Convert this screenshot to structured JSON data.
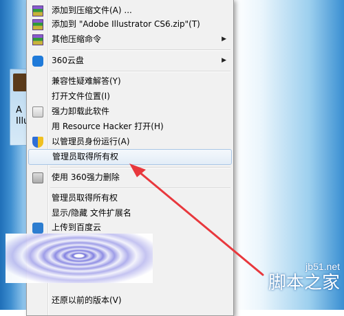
{
  "desktop": {
    "icon_label": "A\nIllu"
  },
  "menu": {
    "items": [
      {
        "label": "添加到压缩文件(A) ...",
        "icon": "winrar-icon"
      },
      {
        "label": "添加到 \"Adobe Illustrator CS6.zip\"(T)",
        "icon": "winrar-icon"
      },
      {
        "label": "其他压缩命令",
        "icon": "winrar-icon",
        "submenu": true
      },
      {
        "label": "360云盘",
        "icon": "cloud-disk-icon",
        "submenu": true
      },
      {
        "label": "兼容性疑难解答(Y)",
        "icon": ""
      },
      {
        "label": "打开文件位置(I)",
        "icon": ""
      },
      {
        "label": "强力卸载此软件",
        "icon": "trash-icon"
      },
      {
        "label": "用 Resource Hacker 打开(H)",
        "icon": ""
      },
      {
        "label": "以管理员身份运行(A)",
        "icon": "uac-shield-icon"
      },
      {
        "label": "管理员取得所有权",
        "icon": "",
        "highlighted": true
      },
      {
        "label": "使用 360强力删除",
        "icon": "shredder-icon"
      },
      {
        "label": "管理员取得所有权",
        "icon": ""
      },
      {
        "label": "显示/隐藏 文件扩展名",
        "icon": ""
      },
      {
        "label": "上传到百度云",
        "icon": "upload-cloud-icon"
      },
      {
        "label": "还原以前的版本(V)",
        "icon": ""
      }
    ],
    "submenu_arrow": "▶"
  },
  "watermark": {
    "small": "jb51.net",
    "big": "脚本之家"
  },
  "colors": {
    "annotation_arrow": "#e8383d",
    "highlight_border": "#a9c6e6"
  }
}
